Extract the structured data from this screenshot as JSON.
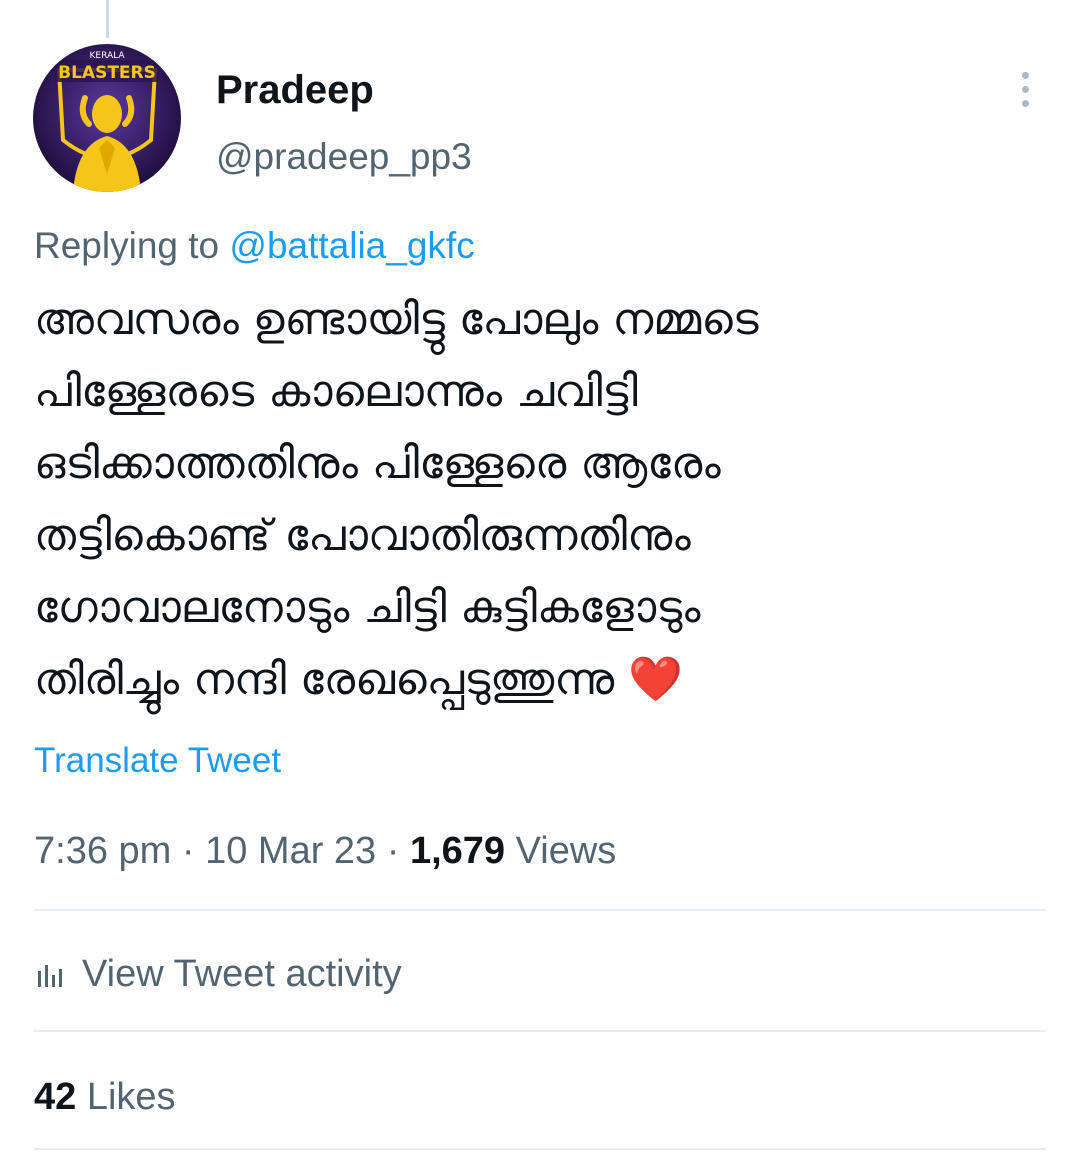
{
  "user": {
    "display_name": "Pradeep",
    "handle": "@pradeep_pp3",
    "avatar_text_top": "KERALA",
    "avatar_text_main": "BLASTERS"
  },
  "reply": {
    "prefix": "Replying to ",
    "mention": "@battalia_gkfc"
  },
  "tweet": {
    "text": "അവസരം ഉണ്ടായിട്ടു പോലും നമ്മടെ\nപിള്ളേരടെ കാലൊന്നും ചവിട്ടി\nഒടിക്കാത്തതിനും പിള്ളേരെ ആരേം\nതട്ടികൊണ്ട് പോവാതിരുന്നതിനും\nഗോവാലനോടും ചിട്ടി കുട്ടികളോടും\nതിരിച്ചും നന്ദി രേഖപ്പെടുത്തുന്നു ",
    "emoji": "❤️",
    "translate_label": "Translate Tweet"
  },
  "meta": {
    "time": "7:36 pm",
    "separator": " · ",
    "date": "10 Mar 23",
    "views_count": "1,679",
    "views_label": " Views"
  },
  "activity": {
    "label": "View Tweet activity",
    "icon": "analytics-icon"
  },
  "likes": {
    "count": "42",
    "label": " Likes"
  },
  "menu_icon": "more-vertical-icon",
  "colors": {
    "accent": "#1d9bf0",
    "secondary_text": "#536471",
    "primary_text": "#0f1419",
    "heart": "#e0245e",
    "avatar_bg": "#3b1f6e",
    "avatar_yellow": "#f5c518"
  }
}
